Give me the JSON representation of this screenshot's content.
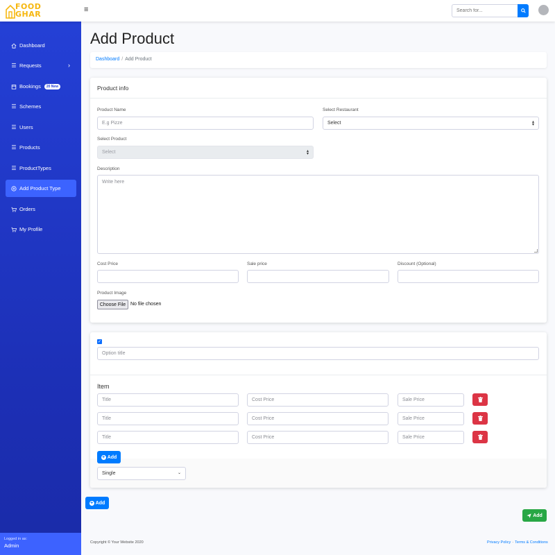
{
  "brand": {
    "logo_line1": "FOOD",
    "logo_line2": "GHAR",
    "accent": "#f6b70f"
  },
  "topbar": {
    "search_placeholder": "Search for...",
    "menu_icon": "hamburger-icon",
    "search_icon": "search-icon"
  },
  "sidebar": {
    "items": [
      {
        "label": "Dashboard",
        "icon": "home-icon"
      },
      {
        "label": "Requests",
        "icon": "list-icon"
      },
      {
        "label": "Bookings",
        "icon": "calendar-icon",
        "badge": "20 New"
      },
      {
        "label": "Schemes",
        "icon": "list-icon"
      },
      {
        "label": "Users",
        "icon": "list-icon"
      },
      {
        "label": "Products",
        "icon": "list-icon"
      },
      {
        "label": "ProductTypes",
        "icon": "list-icon"
      },
      {
        "label": "Add Product Type",
        "icon": "plus-circle-icon"
      },
      {
        "label": "Orders",
        "icon": "cart-icon"
      },
      {
        "label": "My Profile",
        "icon": "cart-icon"
      }
    ],
    "logged_in_label": "Logged in as:",
    "logged_in_user": "Admin",
    "color": "#2440d6"
  },
  "page": {
    "title": "Add Product",
    "breadcrumb": {
      "home": "Dashboard",
      "sep": "/",
      "current": "Add Product"
    }
  },
  "product_info": {
    "header": "Product info",
    "product_name_label": "Product Name",
    "product_name_placeholder": "E.g Pizze",
    "restaurant_label": "Select Restaurant",
    "restaurant_value": "Select",
    "product_label": "Select Product",
    "product_value": "Select",
    "description_label": "Description",
    "description_placeholder": "Write here",
    "cost_price_label": "Cost Price",
    "sale_price_label": "Sale price",
    "discount_label": "Discount (Optional)",
    "image_label": "Product Image",
    "choose_file": "Choose File",
    "no_file": "No file chosen"
  },
  "options": {
    "option_title_placeholder": "Option title",
    "item_heading": "Item",
    "rows": [
      {
        "title": "Title",
        "cost": "Cost Price",
        "sale": "Sale Price"
      },
      {
        "title": "Title",
        "cost": "Cost Price",
        "sale": "Sale Price"
      },
      {
        "title": "Title",
        "cost": "Cost Price",
        "sale": "Sale Price"
      }
    ],
    "add_item_label": "Add",
    "type_value": "Single"
  },
  "actions": {
    "add_option_label": "Add",
    "submit_label": "Add"
  },
  "footer": {
    "copyright": "Copyright © Your Website 2020",
    "privacy": "Privacy Policy",
    "sep": "·",
    "terms": "Terms & Conditions"
  }
}
